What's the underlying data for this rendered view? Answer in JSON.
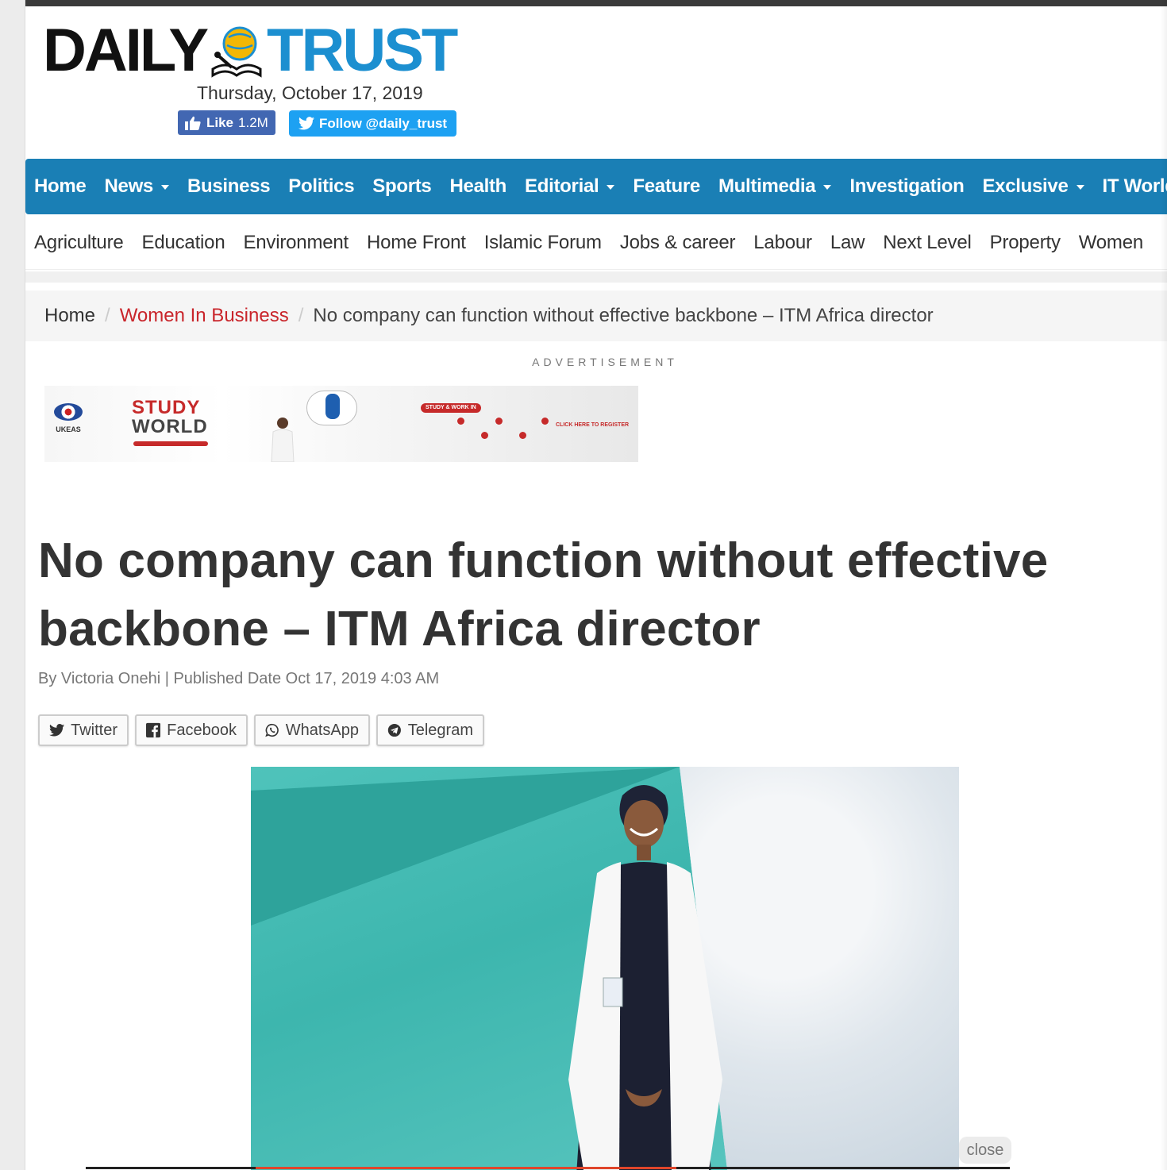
{
  "brand": {
    "logo_left": "DAILY",
    "logo_right": "TRUST",
    "date": "Thursday, October 17, 2019"
  },
  "social": {
    "fb_like_label": "Like",
    "fb_like_count": "1.2M",
    "twitter_follow_label": "Follow @daily_trust"
  },
  "main_nav": [
    {
      "label": "Home",
      "dropdown": false
    },
    {
      "label": "News",
      "dropdown": true
    },
    {
      "label": "Business",
      "dropdown": false
    },
    {
      "label": "Politics",
      "dropdown": false
    },
    {
      "label": "Sports",
      "dropdown": false
    },
    {
      "label": "Health",
      "dropdown": false
    },
    {
      "label": "Editorial",
      "dropdown": true
    },
    {
      "label": "Feature",
      "dropdown": false
    },
    {
      "label": "Multimedia",
      "dropdown": true
    },
    {
      "label": "Investigation",
      "dropdown": false
    },
    {
      "label": "Exclusive",
      "dropdown": true
    },
    {
      "label": "IT World",
      "dropdown": false
    }
  ],
  "sub_nav": [
    "Agriculture",
    "Education",
    "Environment",
    "Home Front",
    "Islamic Forum",
    "Jobs & career",
    "Labour",
    "Law",
    "Next Level",
    "Property",
    "Women"
  ],
  "breadcrumb": {
    "home": "Home",
    "category": "Women In Business",
    "current": "No company can function without effective backbone – ITM Africa director"
  },
  "ad": {
    "label": "ADVERTISEMENT",
    "brand": "UKEAS",
    "headline_1": "STUDY",
    "headline_2": "WORLD",
    "pill": "STUDY & WORK IN",
    "cta": "CLICK HERE TO REGISTER"
  },
  "article": {
    "title": "No company can function without effective backbone – ITM Africa director",
    "byline": "By Victoria Onehi | Published Date Oct 17, 2019 4:03 AM"
  },
  "share_buttons": [
    {
      "label": "Twitter",
      "icon": "twitter-icon"
    },
    {
      "label": "Facebook",
      "icon": "facebook-icon"
    },
    {
      "label": "WhatsApp",
      "icon": "whatsapp-icon"
    },
    {
      "label": "Telegram",
      "icon": "telegram-icon"
    }
  ],
  "overlay": {
    "close_label": "close"
  },
  "colors": {
    "brand_blue": "#1a7fb5",
    "category_red": "#c9252b",
    "facebook": "#4267b2",
    "twitter": "#1da1f2"
  }
}
